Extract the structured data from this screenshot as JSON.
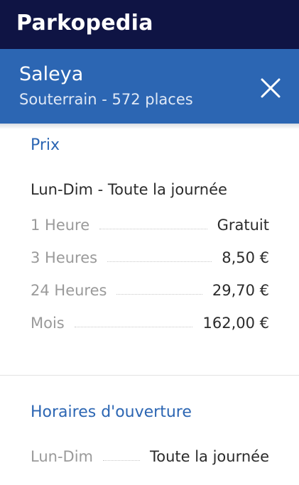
{
  "app": {
    "brand": "Parkopedia"
  },
  "header": {
    "name": "Saleya",
    "subtitle": "Souterrain - 572 places"
  },
  "prices": {
    "title": "Prix",
    "day_range": "Lun-Dim - Toute la journée",
    "rows": [
      {
        "label": "1 Heure",
        "value": "Gratuit"
      },
      {
        "label": "3 Heures",
        "value": "8,50 €"
      },
      {
        "label": "24 Heures",
        "value": "29,70 €"
      },
      {
        "label": "Mois",
        "value": "162,00 €"
      }
    ]
  },
  "hours": {
    "title": "Horaires d'ouverture",
    "rows": [
      {
        "label": "Lun-Dim",
        "value": "Toute la journée"
      }
    ]
  },
  "colors": {
    "topbar": "#0f1444",
    "header": "#2c66b3",
    "accent_text": "#2c66b3"
  },
  "icons": {
    "close": "close-icon"
  }
}
